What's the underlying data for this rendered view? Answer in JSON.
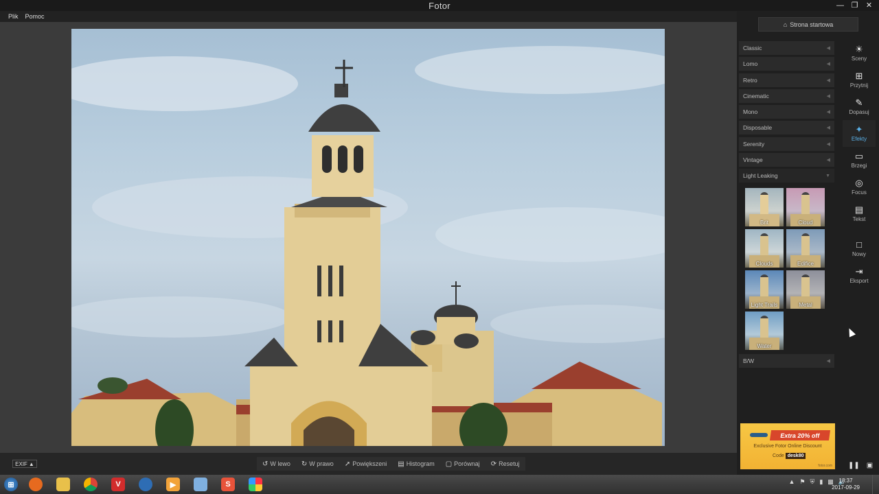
{
  "window": {
    "title": "Fotor",
    "controls": [
      "minimize-icon",
      "restore-icon",
      "close-icon"
    ]
  },
  "menu": {
    "items": [
      {
        "label": "Plik"
      },
      {
        "label": "Pomoc"
      }
    ]
  },
  "bottom_toolbar": {
    "exif_label": "EXIF",
    "tools": [
      {
        "label": "W lewo",
        "icon": "rotate-left-icon"
      },
      {
        "label": "W prawo",
        "icon": "rotate-right-icon"
      },
      {
        "label": "Powiększeni",
        "icon": "zoom-icon"
      },
      {
        "label": "Histogram",
        "icon": "histogram-icon"
      },
      {
        "label": "Porównaj",
        "icon": "compare-icon"
      },
      {
        "label": "Resetuj",
        "icon": "reset-icon"
      }
    ]
  },
  "sidebar": {
    "home_label": "Strona startowa",
    "categories": [
      {
        "label": "Classic"
      },
      {
        "label": "Lomo"
      },
      {
        "label": "Retro"
      },
      {
        "label": "Cinematic"
      },
      {
        "label": "Mono"
      },
      {
        "label": "Disposable"
      },
      {
        "label": "Serenity"
      },
      {
        "label": "Vintage"
      },
      {
        "label": "Light Leaking"
      }
    ],
    "thumbnails": [
      {
        "label": "Brit"
      },
      {
        "label": "Cloud"
      },
      {
        "label": "Clouds"
      },
      {
        "label": "Edifice"
      },
      {
        "label": "Light Trails"
      },
      {
        "label": "Metal"
      },
      {
        "label": "Water"
      }
    ],
    "after_category": {
      "label": "B/W"
    },
    "tools": [
      {
        "label": "Sceny",
        "icon": "sun-icon"
      },
      {
        "label": "Przytnij",
        "icon": "crop-icon"
      },
      {
        "label": "Dopasuj",
        "icon": "pencil-icon"
      },
      {
        "label": "Efekty",
        "icon": "sparkle-icon",
        "active": true
      },
      {
        "label": "Brzegi",
        "icon": "border-icon"
      },
      {
        "label": "Focus",
        "icon": "focus-icon"
      },
      {
        "label": "Tekst",
        "icon": "text-icon"
      },
      {
        "label": "Nowy",
        "icon": "new-file-icon"
      },
      {
        "label": "Eksport",
        "icon": "export-icon"
      }
    ],
    "ad": {
      "headline": "Extra 20% off",
      "subtitle": "Exclusive Fotor Online Discount",
      "code_label": "Code",
      "code_value": "desk80",
      "site": "fotor.com"
    }
  },
  "taskbar": {
    "clock_time": "18:37",
    "clock_date": "2017-09-29"
  },
  "colors": {
    "accent": "#5ab1e8",
    "background": "#3b3b3b",
    "sidebar": "#1f1f1f"
  }
}
